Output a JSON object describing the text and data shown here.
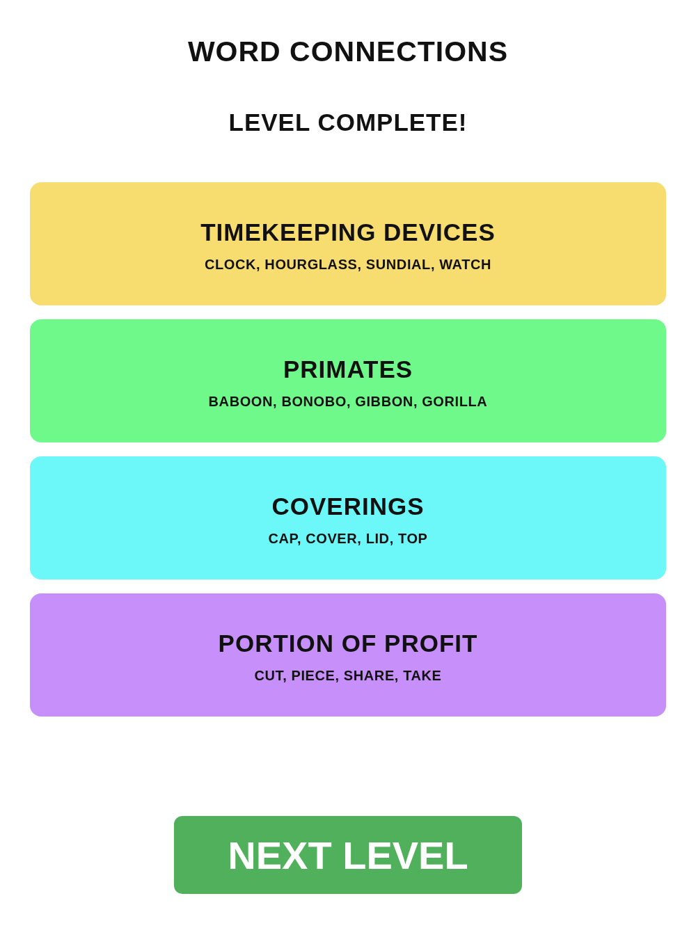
{
  "title": "WORD CONNECTIONS",
  "status": "LEVEL COMPLETE!",
  "groups": [
    {
      "name": "TIMEKEEPING DEVICES",
      "words": "CLOCK, HOURGLASS, SUNDIAL, WATCH",
      "color": "#f7dc6f"
    },
    {
      "name": "PRIMATES",
      "words": "BABOON, BONOBO, GIBBON, GORILLA",
      "color": "#6ef98a"
    },
    {
      "name": "COVERINGS",
      "words": "CAP, COVER, LID, TOP",
      "color": "#6cf8f8"
    },
    {
      "name": "PORTION OF PROFIT",
      "words": "CUT, PIECE, SHARE, TAKE",
      "color": "#c78ffa"
    }
  ],
  "next_button": {
    "label": "NEXT LEVEL"
  }
}
